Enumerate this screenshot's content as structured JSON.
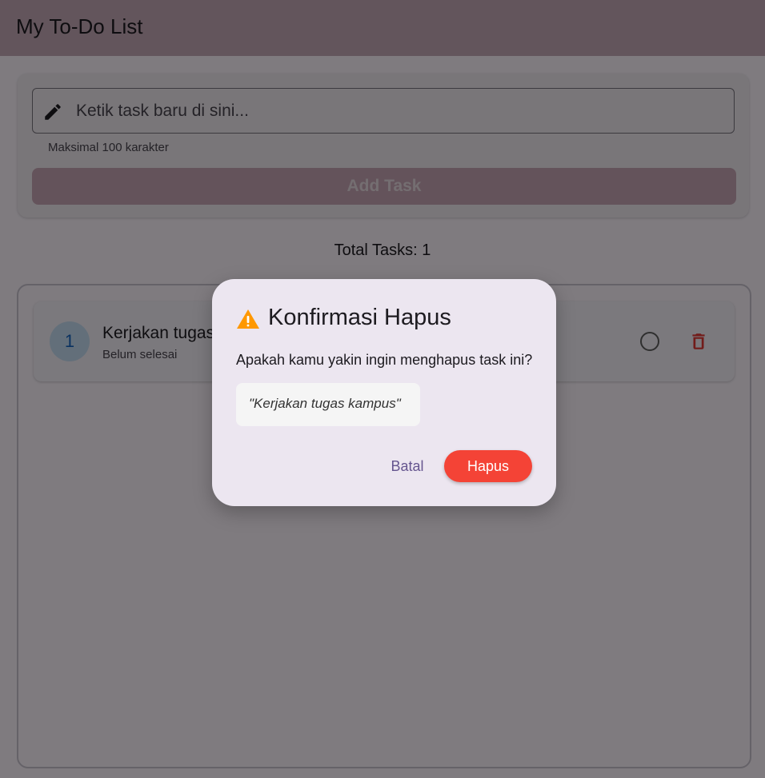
{
  "app": {
    "title": "My To-Do List"
  },
  "input": {
    "placeholder": "Ketik task baru di sini...",
    "value": "",
    "helper": "Maksimal 100 karakter",
    "icon": "pencil-icon"
  },
  "add_button": {
    "label": "Add Task",
    "enabled": false
  },
  "summary": {
    "total_label": "Total Tasks: 1"
  },
  "tasks": [
    {
      "number": "1",
      "title": "Kerjakan tugas kampus",
      "status": "Belum selesai",
      "completed": false
    }
  ],
  "dialog": {
    "icon": "warning-icon",
    "title": "Konfirmasi Hapus",
    "message": "Apakah kamu yakin ingin menghapus task ini?",
    "quoted_task": "\"Kerjakan tugas kampus\"",
    "cancel_label": "Batal",
    "confirm_label": "Hapus"
  },
  "colors": {
    "appbar": "#c7aab8",
    "danger": "#f44336",
    "warning": "#ff9800",
    "accent": "#65558f",
    "number_badge_bg": "#c7dff5",
    "number_badge_text": "#1565c0"
  }
}
